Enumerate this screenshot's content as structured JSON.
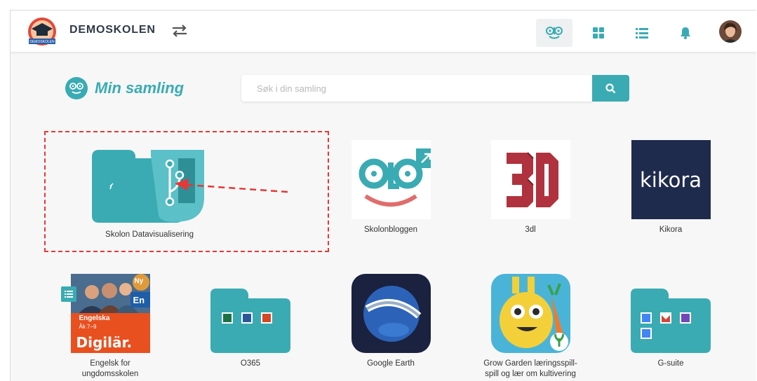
{
  "header": {
    "school_name": "DEMOSKOLEN",
    "logo_text": "DEMOSKOLEN",
    "icons": [
      "school-logo",
      "switch-icon",
      "skolon-face-icon",
      "grid-icon",
      "list-icon",
      "bell-icon",
      "avatar"
    ]
  },
  "page": {
    "title": "Min samling"
  },
  "search": {
    "placeholder": "Søk i din samling"
  },
  "apps": [
    {
      "label": "Skolon Datavisualisering",
      "icon": "folder-git-icon",
      "highlighted": true
    },
    {
      "label": "Skolonbloggen",
      "icon": "skolon-blog-icon"
    },
    {
      "label": "3dl",
      "icon": "3d-icon"
    },
    {
      "label": "Kikora",
      "icon": "kikora-icon",
      "icon_text": "kikora"
    },
    {
      "label": "Engelsk for ungdomsskolen",
      "icon": "digilar-english-icon",
      "badge": "Ny",
      "icon_text_lang": "En",
      "icon_text_title": "Engelska",
      "icon_text_grade": "Åk 7–9",
      "icon_text_brand": "Digilär."
    },
    {
      "label": "O365",
      "icon": "office-folder-icon"
    },
    {
      "label": "Google Earth",
      "icon": "google-earth-icon"
    },
    {
      "label": "Grow Garden læringsspill- spill og lær om kultivering",
      "icon": "grow-garden-icon"
    },
    {
      "label": "G-suite",
      "icon": "gsuite-folder-icon"
    }
  ],
  "colors": {
    "accent": "#3aabb3",
    "highlight": "#e53935",
    "kikora_bg": "#1f2b4d",
    "digilar_bg": "#e8501f"
  }
}
